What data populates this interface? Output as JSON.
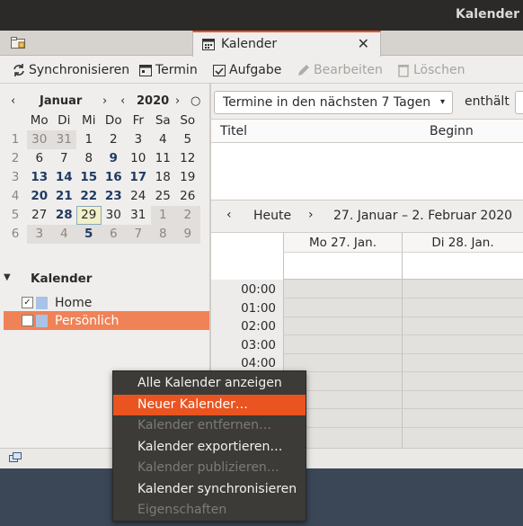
{
  "window": {
    "title": "Kalender"
  },
  "tabs": [
    {
      "label": "",
      "icon": "home-tab-icon"
    },
    {
      "label": "Kalender",
      "icon": "calendar-tab-icon",
      "close": "✕"
    }
  ],
  "toolbar": {
    "sync": "Synchronisieren",
    "event": "Termin",
    "task": "Aufgabe",
    "edit": "Bearbeiten",
    "delete": "Löschen"
  },
  "minical": {
    "prev_month": "‹",
    "month": "Januar",
    "next_month": "›",
    "prev_year": "‹",
    "year": "2020",
    "next_year": "›",
    "today_btn": "○",
    "weekday_headers": [
      "Mo",
      "Di",
      "Mi",
      "Do",
      "Fr",
      "Sa",
      "So"
    ],
    "weeks": [
      {
        "wk": "1",
        "days": [
          "30",
          "31",
          "1",
          "2",
          "3",
          "4",
          "5"
        ]
      },
      {
        "wk": "2",
        "days": [
          "6",
          "7",
          "8",
          "9",
          "10",
          "11",
          "12"
        ]
      },
      {
        "wk": "3",
        "days": [
          "13",
          "14",
          "15",
          "16",
          "17",
          "18",
          "19"
        ]
      },
      {
        "wk": "4",
        "days": [
          "20",
          "21",
          "22",
          "23",
          "24",
          "25",
          "26"
        ]
      },
      {
        "wk": "5",
        "days": [
          "27",
          "28",
          "29",
          "30",
          "31",
          "1",
          "2"
        ]
      },
      {
        "wk": "6",
        "days": [
          "3",
          "4",
          "5",
          "6",
          "7",
          "8",
          "9"
        ]
      }
    ],
    "today": "29"
  },
  "calendars": {
    "title": "Kalender",
    "toggle": "▼",
    "items": [
      {
        "label": "Home",
        "checked": "✓"
      },
      {
        "label": "Persönlich",
        "checked": "✓"
      }
    ]
  },
  "filter": {
    "selected": "Termine in den nächsten 7 Tagen",
    "arrow": "▾",
    "label": "enthält"
  },
  "list": {
    "col_title": "Titel",
    "col_start": "Beginn"
  },
  "nav": {
    "prev": "‹",
    "today": "Heute",
    "next": "›",
    "range": "27. Januar – 2. Februar 2020"
  },
  "week": {
    "days": [
      "Mo 27. Jan.",
      "Di 28. Jan."
    ],
    "times": [
      "00:00",
      "01:00",
      "02:00",
      "03:00",
      "04:00"
    ]
  },
  "context_menu": [
    {
      "label": "Alle Kalender anzeigen",
      "disabled": false,
      "highlighted": false
    },
    {
      "label": "Neuer Kalender…",
      "disabled": false,
      "highlighted": true
    },
    {
      "label": "Kalender entfernen…",
      "disabled": true,
      "highlighted": false
    },
    {
      "label": "Kalender exportieren…",
      "disabled": false,
      "highlighted": false
    },
    {
      "label": "Kalender publizieren…",
      "disabled": true,
      "highlighted": false
    },
    {
      "label": "Kalender synchronisieren",
      "disabled": false,
      "highlighted": false
    },
    {
      "label": "Eigenschaften",
      "disabled": true,
      "highlighted": false
    }
  ]
}
